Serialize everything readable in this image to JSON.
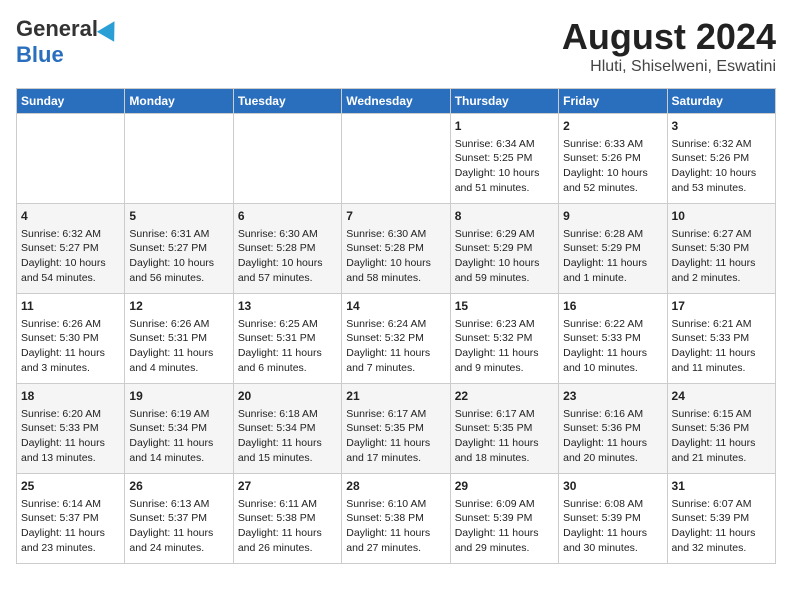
{
  "logo": {
    "general": "General",
    "blue": "Blue"
  },
  "title": "August 2024",
  "subtitle": "Hluti, Shiselweni, Eswatini",
  "days_of_week": [
    "Sunday",
    "Monday",
    "Tuesday",
    "Wednesday",
    "Thursday",
    "Friday",
    "Saturday"
  ],
  "weeks": [
    [
      {
        "day": "",
        "info": ""
      },
      {
        "day": "",
        "info": ""
      },
      {
        "day": "",
        "info": ""
      },
      {
        "day": "",
        "info": ""
      },
      {
        "day": "1",
        "info": "Sunrise: 6:34 AM\nSunset: 5:25 PM\nDaylight: 10 hours\nand 51 minutes."
      },
      {
        "day": "2",
        "info": "Sunrise: 6:33 AM\nSunset: 5:26 PM\nDaylight: 10 hours\nand 52 minutes."
      },
      {
        "day": "3",
        "info": "Sunrise: 6:32 AM\nSunset: 5:26 PM\nDaylight: 10 hours\nand 53 minutes."
      }
    ],
    [
      {
        "day": "4",
        "info": "Sunrise: 6:32 AM\nSunset: 5:27 PM\nDaylight: 10 hours\nand 54 minutes."
      },
      {
        "day": "5",
        "info": "Sunrise: 6:31 AM\nSunset: 5:27 PM\nDaylight: 10 hours\nand 56 minutes."
      },
      {
        "day": "6",
        "info": "Sunrise: 6:30 AM\nSunset: 5:28 PM\nDaylight: 10 hours\nand 57 minutes."
      },
      {
        "day": "7",
        "info": "Sunrise: 6:30 AM\nSunset: 5:28 PM\nDaylight: 10 hours\nand 58 minutes."
      },
      {
        "day": "8",
        "info": "Sunrise: 6:29 AM\nSunset: 5:29 PM\nDaylight: 10 hours\nand 59 minutes."
      },
      {
        "day": "9",
        "info": "Sunrise: 6:28 AM\nSunset: 5:29 PM\nDaylight: 11 hours\nand 1 minute."
      },
      {
        "day": "10",
        "info": "Sunrise: 6:27 AM\nSunset: 5:30 PM\nDaylight: 11 hours\nand 2 minutes."
      }
    ],
    [
      {
        "day": "11",
        "info": "Sunrise: 6:26 AM\nSunset: 5:30 PM\nDaylight: 11 hours\nand 3 minutes."
      },
      {
        "day": "12",
        "info": "Sunrise: 6:26 AM\nSunset: 5:31 PM\nDaylight: 11 hours\nand 4 minutes."
      },
      {
        "day": "13",
        "info": "Sunrise: 6:25 AM\nSunset: 5:31 PM\nDaylight: 11 hours\nand 6 minutes."
      },
      {
        "day": "14",
        "info": "Sunrise: 6:24 AM\nSunset: 5:32 PM\nDaylight: 11 hours\nand 7 minutes."
      },
      {
        "day": "15",
        "info": "Sunrise: 6:23 AM\nSunset: 5:32 PM\nDaylight: 11 hours\nand 9 minutes."
      },
      {
        "day": "16",
        "info": "Sunrise: 6:22 AM\nSunset: 5:33 PM\nDaylight: 11 hours\nand 10 minutes."
      },
      {
        "day": "17",
        "info": "Sunrise: 6:21 AM\nSunset: 5:33 PM\nDaylight: 11 hours\nand 11 minutes."
      }
    ],
    [
      {
        "day": "18",
        "info": "Sunrise: 6:20 AM\nSunset: 5:33 PM\nDaylight: 11 hours\nand 13 minutes."
      },
      {
        "day": "19",
        "info": "Sunrise: 6:19 AM\nSunset: 5:34 PM\nDaylight: 11 hours\nand 14 minutes."
      },
      {
        "day": "20",
        "info": "Sunrise: 6:18 AM\nSunset: 5:34 PM\nDaylight: 11 hours\nand 15 minutes."
      },
      {
        "day": "21",
        "info": "Sunrise: 6:17 AM\nSunset: 5:35 PM\nDaylight: 11 hours\nand 17 minutes."
      },
      {
        "day": "22",
        "info": "Sunrise: 6:17 AM\nSunset: 5:35 PM\nDaylight: 11 hours\nand 18 minutes."
      },
      {
        "day": "23",
        "info": "Sunrise: 6:16 AM\nSunset: 5:36 PM\nDaylight: 11 hours\nand 20 minutes."
      },
      {
        "day": "24",
        "info": "Sunrise: 6:15 AM\nSunset: 5:36 PM\nDaylight: 11 hours\nand 21 minutes."
      }
    ],
    [
      {
        "day": "25",
        "info": "Sunrise: 6:14 AM\nSunset: 5:37 PM\nDaylight: 11 hours\nand 23 minutes."
      },
      {
        "day": "26",
        "info": "Sunrise: 6:13 AM\nSunset: 5:37 PM\nDaylight: 11 hours\nand 24 minutes."
      },
      {
        "day": "27",
        "info": "Sunrise: 6:11 AM\nSunset: 5:38 PM\nDaylight: 11 hours\nand 26 minutes."
      },
      {
        "day": "28",
        "info": "Sunrise: 6:10 AM\nSunset: 5:38 PM\nDaylight: 11 hours\nand 27 minutes."
      },
      {
        "day": "29",
        "info": "Sunrise: 6:09 AM\nSunset: 5:39 PM\nDaylight: 11 hours\nand 29 minutes."
      },
      {
        "day": "30",
        "info": "Sunrise: 6:08 AM\nSunset: 5:39 PM\nDaylight: 11 hours\nand 30 minutes."
      },
      {
        "day": "31",
        "info": "Sunrise: 6:07 AM\nSunset: 5:39 PM\nDaylight: 11 hours\nand 32 minutes."
      }
    ]
  ]
}
